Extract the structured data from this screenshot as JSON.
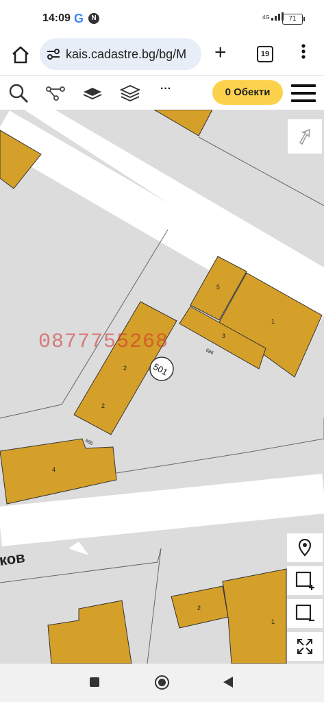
{
  "status": {
    "time": "14:09",
    "g_icon": "G",
    "n_icon": "N",
    "network": "4G",
    "battery": "71"
  },
  "browser": {
    "url": "kais.cadastre.bg/bg/M",
    "tab_count": "19"
  },
  "toolbar": {
    "objects_label": "0 Обекти"
  },
  "overlay": {
    "phone": "0877755268"
  },
  "map": {
    "street_fragment": "ков",
    "parcel_number": "501",
    "building_labels": [
      "5",
      "1",
      "3",
      "2",
      "2",
      "4",
      "2",
      "1"
    ],
    "road_labels": [
      "686",
      "686"
    ]
  },
  "colors": {
    "accent": "#fcd24c",
    "building": "#d4a02a",
    "map_bg": "#dcdcdc"
  }
}
